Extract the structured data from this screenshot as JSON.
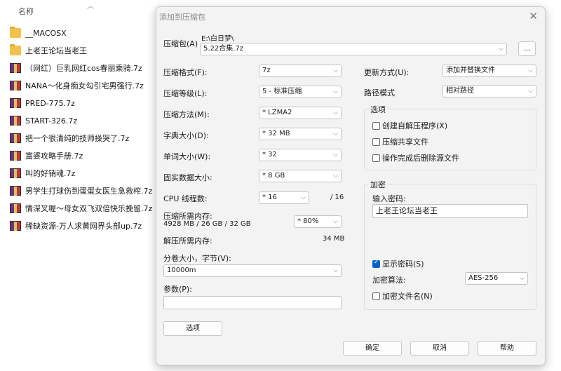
{
  "explorer": {
    "column_name": "名称",
    "header_extra": [
      "",
      "",
      ""
    ],
    "files": [
      {
        "name": "__MACOSX",
        "type": "folder"
      },
      {
        "name": "上老王论坛当老王",
        "type": "folder"
      },
      {
        "name": "（网红）巨乳网红cos春丽乘骑.7z",
        "type": "archive"
      },
      {
        "name": "NANA～化身痴女勾引宅男强行.7z",
        "type": "archive"
      },
      {
        "name": "PRED-775.7z",
        "type": "archive"
      },
      {
        "name": "START-326.7z",
        "type": "archive"
      },
      {
        "name": "把一个很清纯的技师操哭了.7z",
        "type": "archive"
      },
      {
        "name": "富婆攻略手册.7z",
        "type": "archive"
      },
      {
        "name": "叫的好销魂.7z",
        "type": "archive"
      },
      {
        "name": "男学生打球伤到蛋蛋女医生急救榨.7z",
        "type": "archive"
      },
      {
        "name": "情深叉喔～母女双飞双倍快乐挽留.7z",
        "type": "archive"
      },
      {
        "name": "稀缺资源-万人求黄网界头部up.7z",
        "type": "archive"
      }
    ]
  },
  "dialog": {
    "title": "添加到压缩包",
    "close_icon": "close-icon",
    "archive_label": "压缩包(A)",
    "archive_path": "E:\\白日梦\\",
    "archive_name": "5.22合集.7z",
    "browse_label": "...",
    "left": {
      "format_label": "压缩格式(F):",
      "format_value": "7z",
      "level_label": "压缩等级(L):",
      "level_value": "5 - 标准压缩",
      "method_label": "压缩方法(M):",
      "method_value": "* LZMA2",
      "dict_label": "字典大小(D):",
      "dict_value": "* 32 MB",
      "word_label": "单词大小(W):",
      "word_value": "* 32",
      "solid_label": "固实数据大小:",
      "solid_value": "* 8 GB",
      "cpu_label": "CPU 线程数:",
      "cpu_value": "* 16",
      "cpu_total": "/ 16",
      "mem_label": "压缩所需内存:",
      "mem_value": "4928 MB / 26 GB / 32 GB",
      "mem_percent": "* 80%",
      "decomp_label": "解压所需内存:",
      "decomp_value": "34 MB",
      "split_label": "分卷大小，字节(V):",
      "split_value": "10000m",
      "params_label": "参数(P):",
      "params_value": "",
      "options_button": "选项"
    },
    "right": {
      "update_label": "更新方式(U):",
      "update_value": "添加并替换文件",
      "path_label": "路径模式",
      "path_value": "相对路径",
      "options_group": "选项",
      "opt_sfx": "创建自解压程序(X)",
      "opt_shared": "压缩共享文件",
      "opt_delete": "操作完成后删除源文件",
      "encryption_group": "加密",
      "password_label": "输入密码:",
      "password_value": "上老王论坛当老王",
      "show_password": "显示密码(S)",
      "method_label": "加密算法:",
      "method_value": "AES-256",
      "encrypt_names": "加密文件名(N)"
    },
    "ok": "确定",
    "cancel": "取消",
    "help": "帮助"
  }
}
